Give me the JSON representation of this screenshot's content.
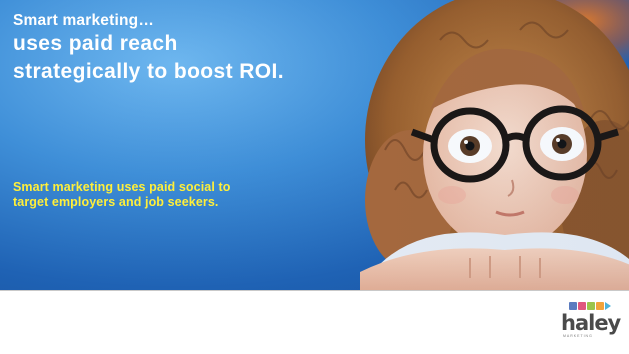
{
  "slide": {
    "headline_line1": "Smart marketing…",
    "headline_line2": "uses paid reach",
    "headline_line3": "strategically to boost ROI.",
    "subtext_line1": "Smart marketing uses paid social to",
    "subtext_line2": "target employers and job seekers."
  },
  "logo": {
    "word": "haley",
    "tagline": "MARKETING",
    "swatch_colors": [
      "#5b7bbf",
      "#e0567e",
      "#9bc44a",
      "#f2a33a",
      "#4fb3d9"
    ]
  },
  "colors": {
    "headline": "#ffffff",
    "subtext": "#ffef3a",
    "background": "#2a74c8"
  }
}
